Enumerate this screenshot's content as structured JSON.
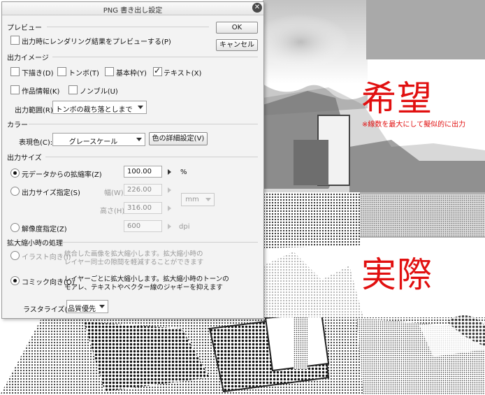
{
  "dialog": {
    "title": "PNG 書き出し設定",
    "ok": "OK",
    "cancel": "キャンセル"
  },
  "preview": {
    "section": "プレビュー",
    "checkbox": "出力時にレンダリング結果をプレビューする(P)",
    "checked": false
  },
  "output_image": {
    "section": "出力イメージ",
    "items": [
      {
        "label": "下描き(D)",
        "checked": false
      },
      {
        "label": "トンボ(T)",
        "checked": false
      },
      {
        "label": "基本枠(Y)",
        "checked": false
      },
      {
        "label": "テキスト(X)",
        "checked": true
      },
      {
        "label": "作品情報(K)",
        "checked": false
      },
      {
        "label": "ノンブル(U)",
        "checked": false
      }
    ],
    "range_label": "出力範囲(R):",
    "range_value": "トンボの裁ち落としまで"
  },
  "color": {
    "section": "カラー",
    "label": "表現色(C):",
    "value": "グレースケール",
    "detail_button": "色の詳細設定(V)"
  },
  "output_size": {
    "section": "出力サイズ",
    "scale_label": "元データからの拡縮率(Z)",
    "scale_value": "100.00",
    "scale_unit": "%",
    "size_label": "出力サイズ指定(S)",
    "width_label": "幅(W):",
    "width_value": "226.00",
    "height_label": "高さ(H):",
    "height_value": "316.00",
    "size_unit": "mm",
    "res_label": "解像度指定(Z)",
    "res_value": "600",
    "res_unit": "dpi"
  },
  "scaling": {
    "section": "拡大縮小時の処理",
    "illust_label": "イラスト向き(I)",
    "illust_desc_1": "統合した画像を拡大縮小します。拡大縮小時の",
    "illust_desc_2": "レイヤー同士の隙間を軽減することができます",
    "comic_label": "コミック向き(O)",
    "comic_desc_1": "レイヤーごとに拡大縮小します。拡大縮小時のトーンの",
    "comic_desc_2": "モアレ、テキストやベクター線のジャギーを抑えます",
    "raster_label": "ラスタライズ(A):",
    "raster_value": "品質優先"
  },
  "annotations": {
    "hope": "希望",
    "hope_note": "※線数を最大にして擬似的に出力",
    "actual": "実際"
  },
  "colors": {
    "accent_red": "#e11010",
    "dialog_bg": "#f3f3f3"
  }
}
